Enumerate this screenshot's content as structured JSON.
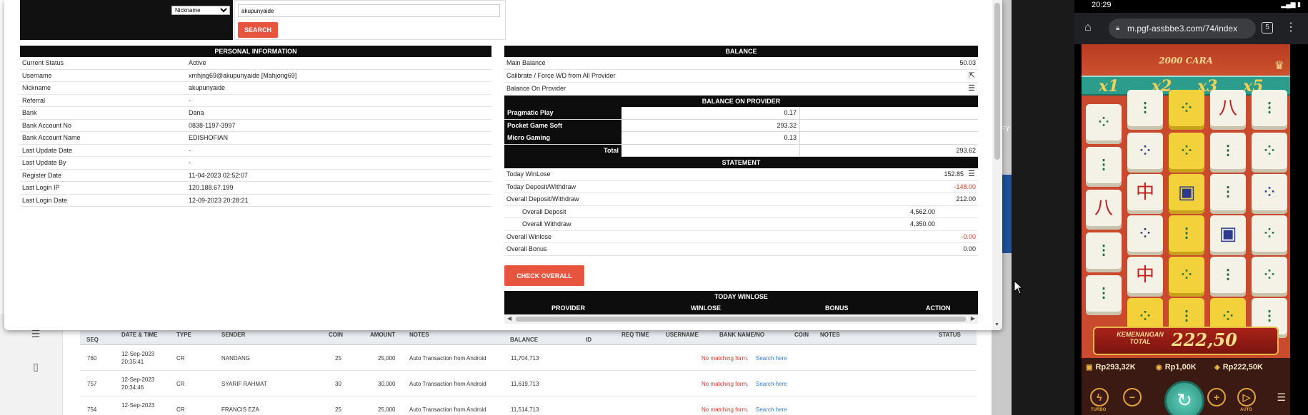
{
  "search": {
    "type_selected": "Nickname",
    "type_options": [
      "Nickname"
    ],
    "query": "akupunyaide",
    "button_label": "SEARCH"
  },
  "personal": {
    "title": "PERSONAL INFORMATION",
    "rows": [
      {
        "label": "Current Status",
        "value": "Active"
      },
      {
        "label": "Username",
        "value": "xmhjng69@akupunyaide  [Mahjong69]"
      },
      {
        "label": "Nickname",
        "value": "akupunyaide"
      },
      {
        "label": "Referral",
        "value": "-"
      },
      {
        "label": "Bank",
        "value": "Dana"
      },
      {
        "label": "Bank Account No",
        "value": "0838-1197-3997"
      },
      {
        "label": "Bank Account Name",
        "value": "EDISHOFIAN"
      },
      {
        "label": "Last Update Date",
        "value": "-"
      },
      {
        "label": "Last Update By",
        "value": "-"
      },
      {
        "label": "Register Date",
        "value": "11-04-2023 02:52:07"
      },
      {
        "label": "Last Login IP",
        "value": "120.188.67.199"
      },
      {
        "label": "Last Login Date",
        "value": "12-09-2023 20:28:21"
      }
    ]
  },
  "balance": {
    "title": "BALANCE",
    "main_label": "Main Balance",
    "main_value": "50.03",
    "calibrate_label": "Calibrate / Force WD from All Provider",
    "on_provider_label": "Balance On Provider",
    "provider_title": "BALANCE ON PROVIDER",
    "providers": [
      {
        "name": "Pragmatic Play",
        "value": "0.17"
      },
      {
        "name": "Pocket Game Soft",
        "value": "293.32"
      },
      {
        "name": "Micro Gaming",
        "value": "0.13"
      }
    ],
    "total_label": "Total",
    "total_value": "293.62"
  },
  "statement": {
    "title": "STATEMENT",
    "today_winlose_label": "Today WinLose",
    "today_winlose_value": "152.85",
    "today_dw_label": "Today Deposit/Withdraw",
    "today_dw_value": "-148.00",
    "overall_dw_label": "Overall Deposit/Withdraw",
    "overall_dw_value": "212.00",
    "overall_deposit_label": "Overall Deposit",
    "overall_deposit_value": "4,562.00",
    "overall_withdraw_label": "Overall Withdraw",
    "overall_withdraw_value": "4,350.00",
    "overall_winlose_label": "Overall Winlose",
    "overall_winlose_value": "-0.00",
    "overall_bonus_label": "Overall Bonus",
    "overall_bonus_value": "0.00",
    "check_overall_label": "CHECK OVERALL"
  },
  "today_winlose": {
    "title": "TODAY WINLOSE",
    "columns": [
      "PROVIDER",
      "WINLOSE",
      "BONUS",
      "ACTION"
    ]
  },
  "bg_table": {
    "headers": [
      "SEQ",
      "DATE & TIME",
      "TYPE",
      "SENDER",
      "COIN",
      "AMOUNT",
      "NOTES",
      "BALANCE",
      "ID",
      "REQ TIME",
      "USERNAME",
      "BANK NAME/NO",
      "COIN",
      "NOTES",
      "STATUS"
    ],
    "rows": [
      {
        "seq": "760",
        "date": "12-Sep-2023",
        "time": "20:35:41",
        "type": "CR",
        "sender": "NANDANG",
        "coin": "25",
        "amount": "25,000",
        "notes": "Auto Transaction from Android",
        "balance": "11,704,713",
        "status": "No matching form.",
        "link": "Search here"
      },
      {
        "seq": "757",
        "date": "12-Sep-2023",
        "time": "20:34:46",
        "type": "CR",
        "sender": "SYARIF RAHMAT",
        "coin": "30",
        "amount": "30,000",
        "notes": "Auto Transaction from Android",
        "balance": "11,619,713",
        "status": "No matching form.",
        "link": "Search here"
      },
      {
        "seq": "754",
        "date": "12-Sep-2023",
        "time": "",
        "type": "CR",
        "sender": "FRANCIS EZA",
        "coin": "25",
        "amount": "25,000",
        "notes": "Auto Transaction from Android",
        "balance": "11,514,713",
        "status": "No matching form.",
        "link": "Search here"
      }
    ],
    "strip_text": "FY"
  },
  "phone": {
    "time": "20:29",
    "url": "m.pgf-assbbe3.com/74/index",
    "tab_count": "5",
    "game": {
      "ways": "2000 CARA",
      "multipliers": [
        "x1",
        "x2",
        "x3",
        "x5"
      ],
      "win_label": "KEMENANGAN TOTAL",
      "win_amount": "222,50",
      "balance": "Rp293,32K",
      "bet": "Rp1,00K",
      "win": "Rp222,50K",
      "turbo_label": "TURBO",
      "auto_label": "AUTO"
    }
  },
  "colors": {
    "accent": "#e8553e",
    "header_bg": "#0d0d0d",
    "negative": "#d9392b",
    "link": "#2f7fd6"
  }
}
